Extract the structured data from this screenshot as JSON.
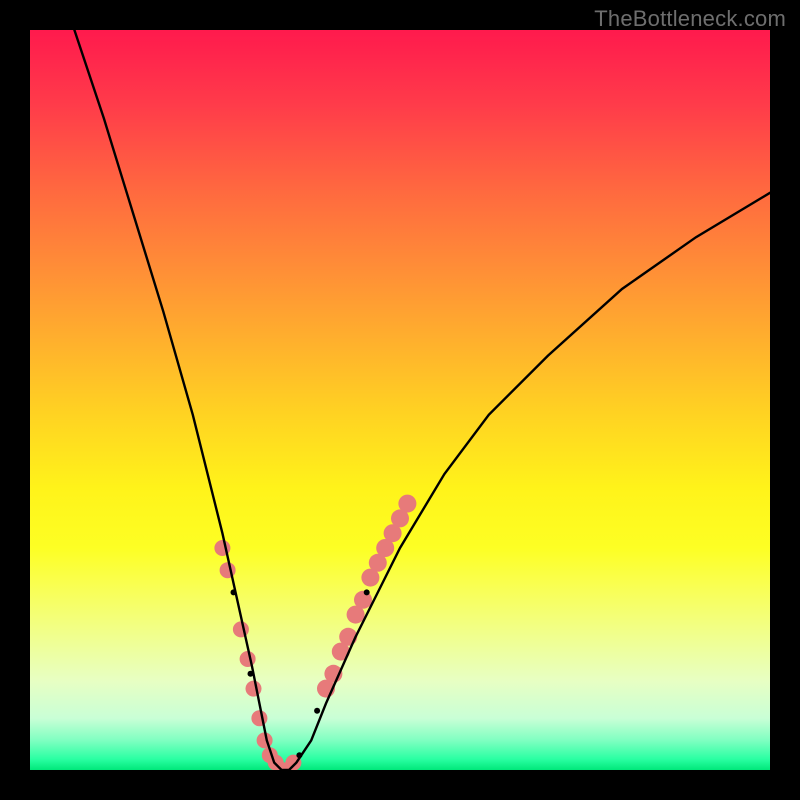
{
  "watermark": "TheBottleneck.com",
  "chart_data": {
    "type": "line",
    "title": "",
    "xlabel": "",
    "ylabel": "",
    "xlim": [
      0,
      100
    ],
    "ylim": [
      0,
      100
    ],
    "background_gradient": {
      "top_color": "#ff1a4d",
      "mid_color": "#fff31a",
      "bottom_color": "#00e87a",
      "meaning": "bottleneck severity (red=high, green=none)"
    },
    "series": [
      {
        "name": "bottleneck-curve",
        "color": "#000000",
        "x": [
          6,
          10,
          14,
          18,
          22,
          26,
          28,
          30,
          31,
          32,
          33,
          34,
          35,
          36,
          38,
          40,
          44,
          50,
          56,
          62,
          70,
          80,
          90,
          100
        ],
        "y": [
          100,
          88,
          75,
          62,
          48,
          32,
          23,
          14,
          9,
          4,
          1,
          0,
          0,
          1,
          4,
          9,
          18,
          30,
          40,
          48,
          56,
          65,
          72,
          78
        ]
      }
    ],
    "markers": [
      {
        "name": "left-cluster",
        "color": "#e77a7a",
        "radius": 8,
        "points": [
          {
            "x": 26.0,
            "y": 30
          },
          {
            "x": 26.7,
            "y": 27
          },
          {
            "x": 28.5,
            "y": 19
          },
          {
            "x": 29.4,
            "y": 15
          },
          {
            "x": 30.2,
            "y": 11
          },
          {
            "x": 31.0,
            "y": 7
          },
          {
            "x": 31.7,
            "y": 4
          },
          {
            "x": 32.4,
            "y": 2
          },
          {
            "x": 33.2,
            "y": 1
          },
          {
            "x": 34.0,
            "y": 0
          },
          {
            "x": 34.8,
            "y": 0
          },
          {
            "x": 35.6,
            "y": 1
          }
        ]
      },
      {
        "name": "right-cluster",
        "color": "#e77a7a",
        "radius": 9,
        "points": [
          {
            "x": 40.0,
            "y": 11
          },
          {
            "x": 41.0,
            "y": 13
          },
          {
            "x": 42.0,
            "y": 16
          },
          {
            "x": 43.0,
            "y": 18
          },
          {
            "x": 44.0,
            "y": 21
          },
          {
            "x": 45.0,
            "y": 23
          },
          {
            "x": 46.0,
            "y": 26
          },
          {
            "x": 47.0,
            "y": 28
          },
          {
            "x": 48.0,
            "y": 30
          },
          {
            "x": 49.0,
            "y": 32
          },
          {
            "x": 50.0,
            "y": 34
          },
          {
            "x": 51.0,
            "y": 36
          }
        ]
      }
    ],
    "curve_black_dots": [
      {
        "x": 27.5,
        "y": 24
      },
      {
        "x": 29.8,
        "y": 13
      },
      {
        "x": 36.4,
        "y": 2
      },
      {
        "x": 38.8,
        "y": 8
      },
      {
        "x": 45.5,
        "y": 24
      }
    ]
  }
}
